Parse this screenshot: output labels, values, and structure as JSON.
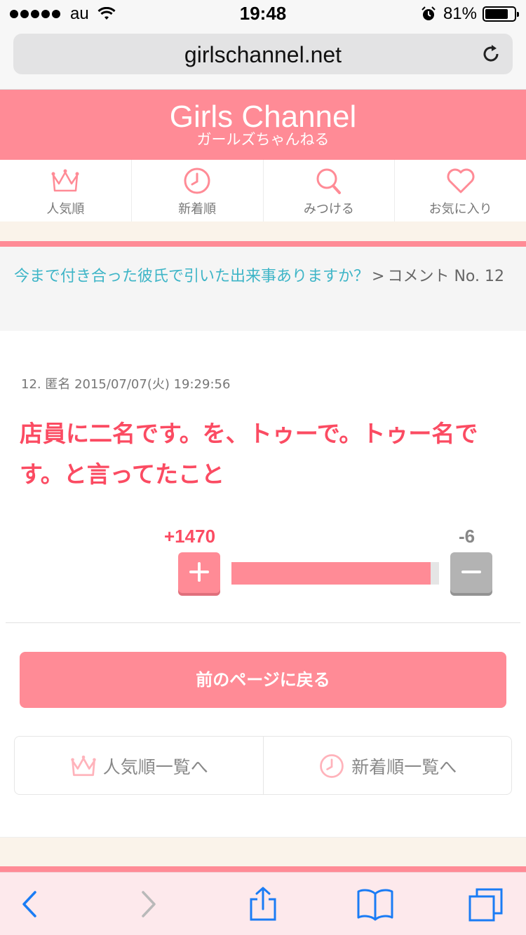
{
  "status_bar": {
    "carrier": "au",
    "time": "19:48",
    "battery": "81%",
    "battery_level": 0.81
  },
  "url_bar": {
    "url": "girlschannel.net"
  },
  "header": {
    "logo": "Girls Channel",
    "logo_sub": "ガールズちゃんねる"
  },
  "nav": [
    {
      "label": "人気順",
      "icon": "crown-icon"
    },
    {
      "label": "新着順",
      "icon": "clock-icon"
    },
    {
      "label": "みつける",
      "icon": "search-icon"
    },
    {
      "label": "お気に入り",
      "icon": "heart-icon"
    }
  ],
  "breadcrumb": {
    "topic": "今まで付き合った彼氏で引いた出来事ありますか？",
    "separator": ">",
    "current": "コメント No. 12"
  },
  "comment": {
    "meta": "12. 匿名 2015/07/07(火) 19:29:56",
    "body": "店員に二名です。を、トゥーで。トゥー名です。と言ってたこと",
    "plus": "+1470",
    "minus": "-6",
    "plus_ratio": 0.96
  },
  "back_button": "前のページに戻る",
  "links": [
    {
      "label": "人気順一覧へ",
      "icon": "crown-icon"
    },
    {
      "label": "新着順一覧へ",
      "icon": "clock-icon"
    }
  ],
  "colors": {
    "pink": "#ff8b96",
    "red_text": "#fb4b62",
    "link": "#3eb5c7",
    "ios_blue": "#1a7cf5"
  }
}
